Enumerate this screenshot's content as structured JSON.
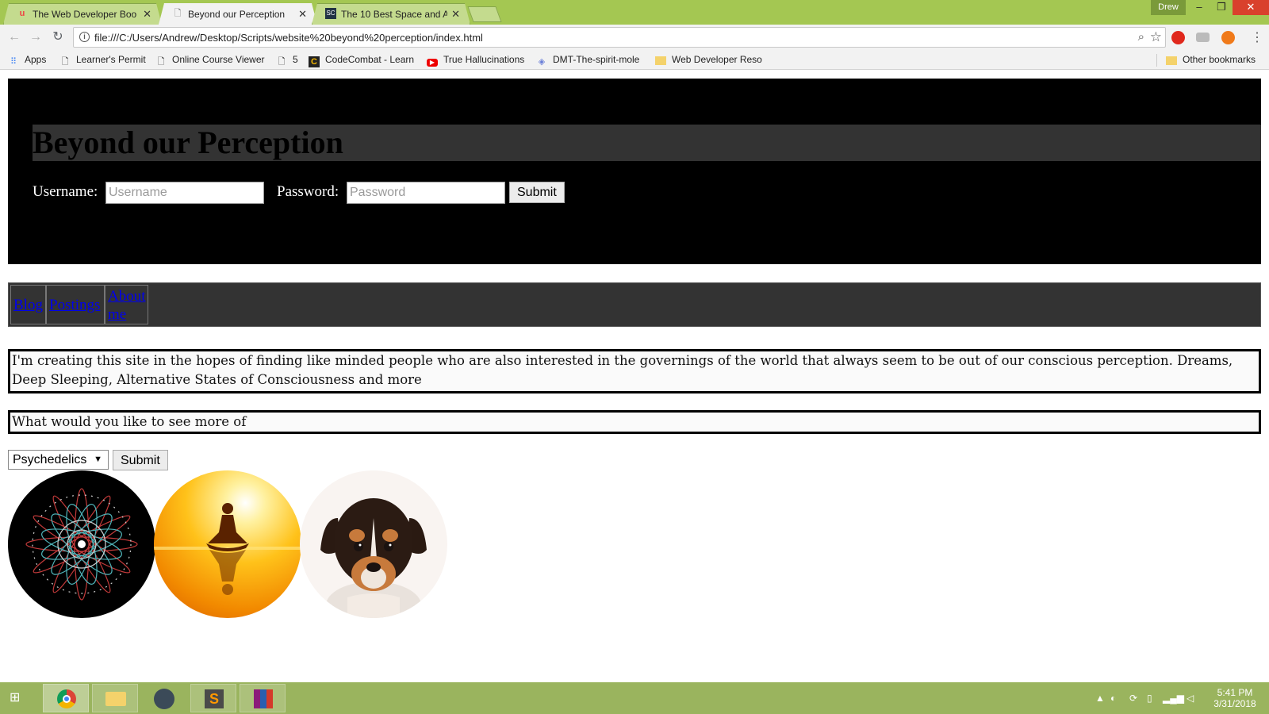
{
  "browser": {
    "tabs": [
      {
        "title": "The Web Developer Boo",
        "favicon": "udemy-icon"
      },
      {
        "title": "Beyond our Perception",
        "favicon": "page-icon"
      },
      {
        "title": "The 10 Best Space and A",
        "favicon": "site-icon"
      }
    ],
    "profile_name": "Drew",
    "url": "file:///C:/Users/Andrew/Desktop/Scripts/website%20beyond%20perception/index.html",
    "bookmarks": [
      "Apps",
      "Learner's Permit",
      "Online Course Viewer",
      "5",
      "CodeCombat - Learn",
      "True Hallucinations",
      "DMT-The-spirit-mole",
      "Web Developer Reso"
    ],
    "other_bookmarks": "Other bookmarks"
  },
  "page": {
    "title": "Beyond our Perception",
    "login": {
      "username_label": "Username:",
      "username_placeholder": "Username",
      "password_label": "Password:",
      "password_placeholder": "Password",
      "submit_label": "Submit"
    },
    "nav": {
      "blog": "Blog",
      "postings": "Postings",
      "about_line1": "About",
      "about_line2": "me"
    },
    "intro_text": "I'm creating this site in the hopes of finding like minded people who are also interested in the governings of the world that always seem to be out of our conscious perception. Dreams, Deep Sleeping, Alternative States of Consciousness and more",
    "question_text": "What would you like to see more of",
    "select_value": "Psychedelics",
    "select_submit": "Submit",
    "images": [
      "mandala-image",
      "meditation-image",
      "puppy-image"
    ]
  },
  "taskbar": {
    "time": "5:41 PM",
    "date": "3/31/2018"
  },
  "colors": {
    "tabstrip": "#a4c752",
    "header_bg": "#000000",
    "title_band": "#333333",
    "nav_bg": "#333333",
    "link": "#0000ee"
  }
}
